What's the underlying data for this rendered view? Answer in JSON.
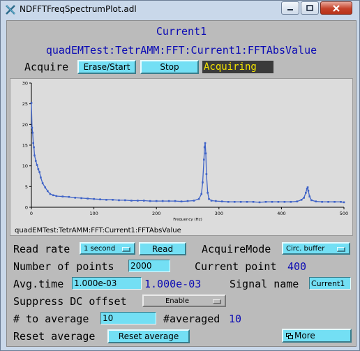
{
  "window": {
    "title": "NDFFTFreqSpectrumPlot.adl"
  },
  "header": {
    "title": "Current1",
    "pv_name": "quadEMTest:TetrAMM:FFT:Current1:FFTAbsValue"
  },
  "acquire": {
    "label": "Acquire",
    "erase_start_label": "Erase/Start",
    "stop_label": "Stop",
    "status": "Acquiring"
  },
  "plot": {
    "caption": "quadEMTest:TetrAMM:FFT:Current1:FFTAbsValue"
  },
  "controls": {
    "read_rate_label": "Read rate",
    "read_rate_value": "1 second",
    "read_button_label": "Read",
    "acquire_mode_label": "AcquireMode",
    "acquire_mode_value": "Circ. buffer",
    "num_points_label": "Number of points",
    "num_points_value": "2000",
    "current_point_label": "Current point",
    "current_point_value": "400",
    "avg_time_label": "Avg.time",
    "avg_time_value": "1.000e-03",
    "avg_time_readback": "1.000e-03",
    "signal_name_label": "Signal name",
    "signal_name_value": "Current1",
    "suppress_dc_label": "Suppress DC offset",
    "suppress_dc_value": "Enable",
    "num_to_average_label": "# to average",
    "num_to_average_value": "10",
    "num_averaged_label": "#averaged",
    "num_averaged_value": "10",
    "reset_average_label": "Reset average",
    "reset_average_button": "Reset average",
    "more_button": "More"
  },
  "colors": {
    "window_frame": "#c9d8ea",
    "panel_bg": "#bbbbbb",
    "control_bg": "#73dff4",
    "readback_text": "#0a0ab4",
    "status_text": "#f3e400",
    "status_bg": "#3a3a3a",
    "trace": "#3f63c7"
  },
  "chart_data": {
    "type": "line",
    "title": "",
    "xlabel": "Frequency (Hz)",
    "ylabel": "",
    "xlim": [
      0,
      500
    ],
    "ylim": [
      0,
      30
    ],
    "x_ticks": [
      0,
      100,
      200,
      300,
      400,
      500
    ],
    "y_ticks": [
      0,
      5,
      10,
      15,
      20,
      25,
      30
    ],
    "grid": false,
    "series": [
      {
        "name": "",
        "color": "#3f63c7",
        "x": [
          0,
          1,
          2,
          3,
          4,
          5,
          7,
          9,
          11,
          13,
          15,
          18,
          22,
          26,
          30,
          35,
          40,
          50,
          60,
          70,
          80,
          90,
          100,
          110,
          120,
          130,
          140,
          150,
          160,
          170,
          180,
          190,
          200,
          210,
          220,
          230,
          240,
          250,
          260,
          268,
          272,
          274,
          276,
          277,
          278,
          279,
          280,
          282,
          284,
          288,
          295,
          305,
          315,
          325,
          335,
          345,
          355,
          365,
          375,
          385,
          395,
          405,
          415,
          425,
          432,
          436,
          439,
          441,
          442,
          443,
          445,
          448,
          455,
          465,
          475,
          485,
          495,
          500
        ],
        "y": [
          25.2,
          19.2,
          18.0,
          15.5,
          14.5,
          12.5,
          11.2,
          10.2,
          9.2,
          8.5,
          7.2,
          5.8,
          4.8,
          3.9,
          3.2,
          2.9,
          2.7,
          2.6,
          2.5,
          2.3,
          2.2,
          2.1,
          2.0,
          1.9,
          1.8,
          1.8,
          1.7,
          1.7,
          1.6,
          1.6,
          1.6,
          1.5,
          1.5,
          1.5,
          1.5,
          1.5,
          1.4,
          1.5,
          1.6,
          2.0,
          3.2,
          6.0,
          11.5,
          14.5,
          15.5,
          13.0,
          8.0,
          3.5,
          2.0,
          1.6,
          1.5,
          1.4,
          1.3,
          1.3,
          1.3,
          1.3,
          1.3,
          1.2,
          1.3,
          1.3,
          1.3,
          1.3,
          1.3,
          1.4,
          1.8,
          2.3,
          3.5,
          4.5,
          4.8,
          4.0,
          2.6,
          1.7,
          1.4,
          1.3,
          1.3,
          1.3,
          1.3,
          1.2
        ]
      }
    ]
  }
}
